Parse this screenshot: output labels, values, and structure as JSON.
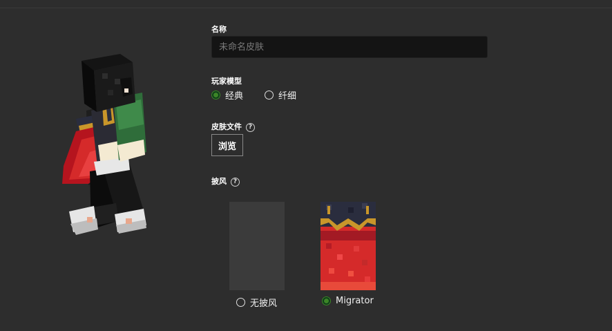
{
  "form": {
    "name_label": "名称",
    "name_placeholder": "未命名皮肤",
    "name_value": "",
    "model_label": "玩家模型",
    "model_options": [
      "经典",
      "纤细"
    ],
    "model_selected": "经典",
    "skin_file_label": "皮肤文件",
    "help_glyph": "?",
    "browse_label": "浏览",
    "cape_label": "披风",
    "cape_options": [
      "无披风",
      "Migrator"
    ],
    "cape_selected": "Migrator"
  },
  "colors": {
    "background": "#2d2d2d",
    "input_background": "#141414",
    "accent_green": "#3c8527",
    "cape_red": "#d52a2a",
    "cape_navy": "#2a2d3e",
    "cape_gold": "#c9962a"
  }
}
